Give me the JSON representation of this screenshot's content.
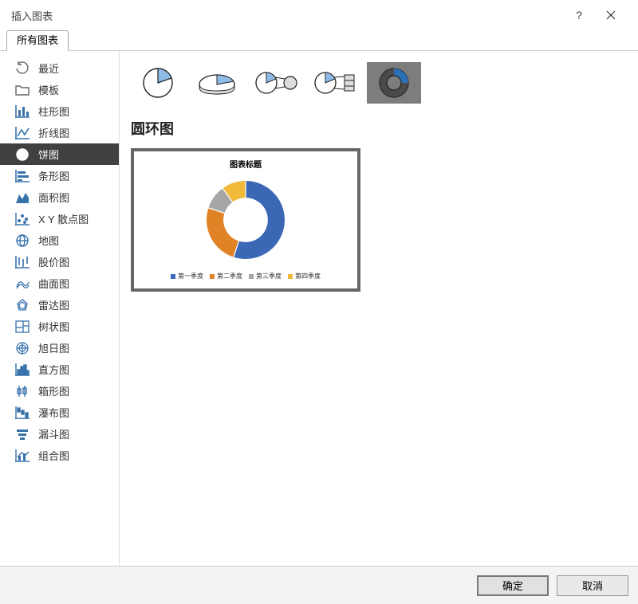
{
  "titlebar": {
    "title": "插入图表"
  },
  "tab": {
    "label": "所有图表"
  },
  "sidebar": {
    "items": [
      {
        "key": "recent",
        "label": "最近"
      },
      {
        "key": "template",
        "label": "模板"
      },
      {
        "key": "column",
        "label": "柱形图"
      },
      {
        "key": "line",
        "label": "折线图"
      },
      {
        "key": "pie",
        "label": "饼图"
      },
      {
        "key": "bar",
        "label": "条形图"
      },
      {
        "key": "area",
        "label": "面积图"
      },
      {
        "key": "scatter",
        "label": "X Y 散点图"
      },
      {
        "key": "map",
        "label": "地图"
      },
      {
        "key": "stock",
        "label": "股价图"
      },
      {
        "key": "surface",
        "label": "曲面图"
      },
      {
        "key": "radar",
        "label": "雷达图"
      },
      {
        "key": "tree",
        "label": "树状图"
      },
      {
        "key": "sunburst",
        "label": "旭日图"
      },
      {
        "key": "histogram",
        "label": "直方图"
      },
      {
        "key": "box",
        "label": "箱形图"
      },
      {
        "key": "waterfall",
        "label": "瀑布图"
      },
      {
        "key": "funnel",
        "label": "漏斗图"
      },
      {
        "key": "combo",
        "label": "组合图"
      }
    ],
    "selected": "pie"
  },
  "section_title": "圆环图",
  "preview": {
    "title": "图表标题",
    "legend": [
      {
        "label": "第一季度",
        "color": "#3b68b5"
      },
      {
        "label": "第二季度",
        "color": "#e08327"
      },
      {
        "label": "第三季度",
        "color": "#a6a6a6"
      },
      {
        "label": "第四季度",
        "color": "#f0b93a"
      }
    ]
  },
  "chart_data": {
    "type": "pie",
    "title": "图表标题",
    "categories": [
      "第一季度",
      "第二季度",
      "第三季度",
      "第四季度"
    ],
    "values": [
      55,
      25,
      10,
      10
    ],
    "colors": [
      "#3b68b5",
      "#e08327",
      "#a6a6a6",
      "#f0b93a"
    ],
    "inner_radius_ratio": 0.55
  },
  "footer": {
    "ok": "确定",
    "cancel": "取消"
  }
}
